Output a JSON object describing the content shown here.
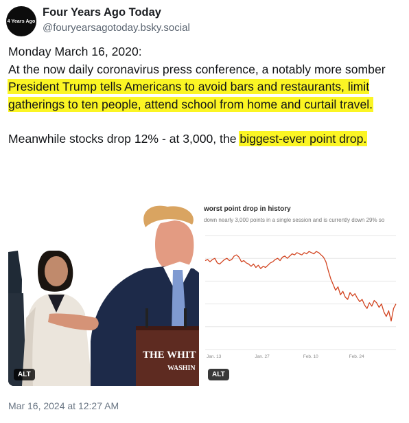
{
  "author": {
    "avatar_text": "4 Years Ago",
    "display_name": "Four Years Ago Today",
    "handle": "@fouryearsagotoday.bsky.social"
  },
  "post": {
    "line1": "Monday March 16, 2020:",
    "p1_plain": "At the now daily coronavirus press conference, a notably more somber ",
    "p1_highlight": "President Trump tells Americans to avoid bars and restaurants, limit gatherings to ten people, attend school from home and curtail travel.",
    "p2_plain": "Meanwhile stocks drop 12% - at 3,000, the ",
    "p2_highlight": "biggest-ever point drop.",
    "highlight_color": "#fbf524"
  },
  "images": {
    "left": {
      "podium_line1": "THE WHIT",
      "podium_line2": "WASHIN",
      "alt_badge": "ALT"
    },
    "right": {
      "alt_badge": "ALT"
    }
  },
  "chart_data": {
    "type": "line",
    "title": "worst point drop in history",
    "subtitle": "down nearly 3,000 points in a single session and is currently down 29% so",
    "xlabel": "",
    "ylabel": "",
    "x_ticks": [
      "Jan. 13",
      "Jan. 27",
      "Feb. 10",
      "Feb. 24",
      ""
    ],
    "series": [
      {
        "name": "",
        "color": "#d2431f",
        "x": [
          0,
          1,
          2,
          3,
          4,
          5,
          6,
          7,
          8,
          9,
          10,
          11,
          12,
          13,
          14,
          15,
          16,
          17,
          18,
          19,
          20,
          21,
          22,
          23,
          24,
          25,
          26,
          27,
          28,
          29,
          30,
          31,
          32,
          33,
          34,
          35,
          36,
          37,
          38,
          39,
          40,
          41,
          42,
          43,
          44,
          45,
          46,
          47,
          48,
          49,
          50,
          51,
          52,
          53,
          54,
          55,
          56,
          57,
          58,
          59,
          60,
          61,
          62,
          63,
          64,
          65,
          66,
          67,
          68,
          69,
          70,
          71,
          72,
          73,
          74,
          75,
          76,
          77,
          78,
          79
        ],
        "values": [
          28.8,
          28.9,
          28.7,
          28.9,
          29.0,
          28.6,
          28.5,
          28.7,
          28.9,
          29.0,
          28.8,
          28.9,
          29.2,
          29.3,
          29.1,
          28.7,
          28.8,
          28.6,
          28.5,
          28.3,
          28.5,
          28.2,
          28.4,
          28.1,
          28.3,
          28.2,
          28.4,
          28.6,
          28.7,
          28.9,
          29.0,
          28.8,
          29.1,
          29.2,
          29.0,
          29.2,
          29.4,
          29.3,
          29.5,
          29.4,
          29.3,
          29.5,
          29.4,
          29.6,
          29.5,
          29.4,
          29.6,
          29.5,
          29.3,
          29.1,
          28.7,
          27.9,
          27.2,
          26.7,
          26.2,
          26.5,
          25.8,
          26.1,
          25.6,
          25.4,
          26.0,
          25.7,
          25.9,
          25.5,
          25.2,
          25.4,
          24.9,
          24.6,
          25.1,
          24.8,
          25.3,
          25.1,
          24.7,
          25.0,
          24.3,
          23.9,
          24.4,
          23.5,
          24.6,
          25.0
        ],
        "ylim": [
          21,
          31
        ]
      }
    ],
    "grid": true,
    "legend": "none"
  },
  "timestamp": "Mar 16, 2024 at 12:27 AM"
}
